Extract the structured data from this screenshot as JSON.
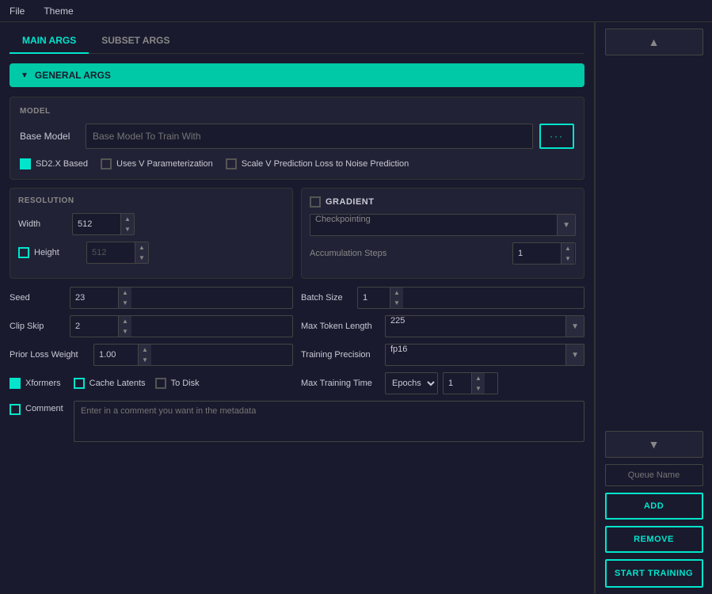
{
  "menubar": {
    "items": [
      "File",
      "Theme"
    ]
  },
  "tabs": {
    "main_args": "MAIN ARGS",
    "subset_args": "SUBSET ARGS"
  },
  "general_args": {
    "label": "GENERAL ARGS"
  },
  "model_section": {
    "label": "MODEL",
    "base_model_label": "Base Model",
    "base_model_placeholder": "Base Model To Train With",
    "browse_btn": "···",
    "sd2x_label": "SD2.X Based",
    "v_param_label": "Uses V Parameterization",
    "scale_v_label": "Scale V Prediction Loss to Noise Prediction"
  },
  "resolution_section": {
    "label": "RESOLUTION",
    "width_label": "Width",
    "width_value": "512",
    "height_label": "Height",
    "height_value": "512"
  },
  "gradient_section": {
    "label": "GRADIENT",
    "checkpointing_placeholder": "Checkpointing",
    "accum_label": "Accumulation Steps",
    "accum_value": "1"
  },
  "fields": {
    "seed_label": "Seed",
    "seed_value": "23",
    "batch_size_label": "Batch Size",
    "batch_size_value": "1",
    "clip_skip_label": "Clip Skip",
    "clip_skip_value": "2",
    "max_token_label": "Max Token Length",
    "max_token_value": "225",
    "prior_loss_label": "Prior Loss Weight",
    "prior_loss_value": "1.00",
    "training_precision_label": "Training Precision",
    "training_precision_value": "fp16",
    "xformers_label": "Xformers",
    "cache_latents_label": "Cache Latents",
    "to_disk_label": "To Disk",
    "max_training_time_label": "Max Training Time",
    "epochs_value": "Epochs",
    "epochs_number": "1",
    "comment_label": "Comment",
    "comment_placeholder": "Enter in a comment you want in the metadata"
  },
  "right_panel": {
    "collapse_up": "▲",
    "collapse_down": "▼",
    "queue_name_placeholder": "Queue Name",
    "add_btn": "ADD",
    "remove_btn": "REMOVE",
    "start_training_btn": "START TRAINING"
  }
}
